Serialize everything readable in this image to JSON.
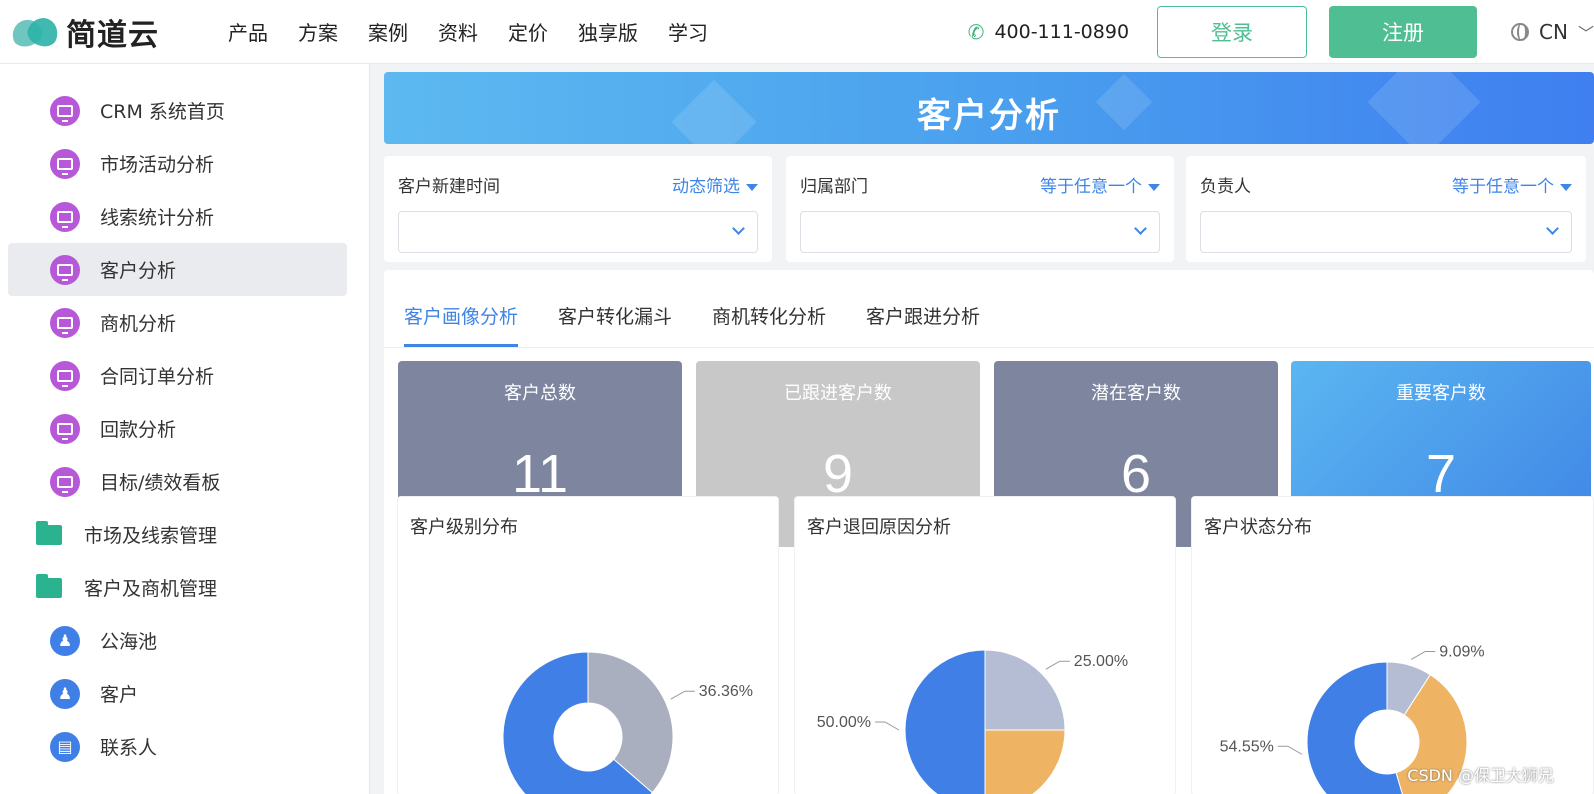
{
  "brand": {
    "name": "简道云"
  },
  "nav": [
    "产品",
    "方案",
    "案例",
    "资料",
    "定价",
    "独享版",
    "学习"
  ],
  "header": {
    "phone": "400-111-0890",
    "login": "登录",
    "register": "注册",
    "lang": "CN"
  },
  "sidebar": {
    "items": [
      {
        "label": "CRM 系统首页",
        "icon": "dashboard-icon",
        "type": "report"
      },
      {
        "label": "市场活动分析",
        "icon": "dashboard-icon",
        "type": "report"
      },
      {
        "label": "线索统计分析",
        "icon": "dashboard-icon",
        "type": "report"
      },
      {
        "label": "客户分析",
        "icon": "dashboard-icon",
        "type": "report",
        "active": true
      },
      {
        "label": "商机分析",
        "icon": "dashboard-icon",
        "type": "report"
      },
      {
        "label": "合同订单分析",
        "icon": "dashboard-icon",
        "type": "report"
      },
      {
        "label": "回款分析",
        "icon": "dashboard-icon",
        "type": "report"
      },
      {
        "label": "目标/绩效看板",
        "icon": "dashboard-icon",
        "type": "report"
      },
      {
        "label": "市场及线索管理",
        "icon": "folder-icon",
        "type": "folder"
      },
      {
        "label": "客户及商机管理",
        "icon": "folder-icon",
        "type": "folder"
      },
      {
        "label": "公海池",
        "icon": "user-icon",
        "type": "form"
      },
      {
        "label": "客户",
        "icon": "user-icon",
        "type": "form"
      },
      {
        "label": "联系人",
        "icon": "contact-icon",
        "type": "form"
      }
    ]
  },
  "banner": {
    "title": "客户分析"
  },
  "filters": [
    {
      "label": "客户新建时间",
      "op": "动态筛选"
    },
    {
      "label": "归属部门",
      "op": "等于任意一个"
    },
    {
      "label": "负责人",
      "op": "等于任意一个"
    }
  ],
  "tabs": [
    {
      "label": "客户画像分析",
      "active": true
    },
    {
      "label": "客户转化漏斗"
    },
    {
      "label": "商机转化分析"
    },
    {
      "label": "客户跟进分析"
    }
  ],
  "stats": [
    {
      "title": "客户总数",
      "value": "11",
      "color": "#7d859f"
    },
    {
      "title": "已跟进客户数",
      "value": "9",
      "color": "#c8c8c8"
    },
    {
      "title": "潜在客户数",
      "value": "6",
      "color": "#7d859f"
    },
    {
      "title": "重要客户数",
      "value": "7",
      "color": "#4ea6ee"
    }
  ],
  "chart_data": [
    {
      "type": "pie",
      "variant": "donut",
      "title": "客户级别分布",
      "slices": [
        {
          "value": 36.36,
          "label": "36.36%",
          "color": "#a9afbf"
        },
        {
          "value": 63.64,
          "label": "",
          "color": "#3f7fe6"
        }
      ]
    },
    {
      "type": "pie",
      "title": "客户退回原因分析",
      "slices": [
        {
          "value": 25.0,
          "label": "25.00%",
          "color": "#b4bdd3"
        },
        {
          "value": 25.0,
          "label": "",
          "color": "#eeb463"
        },
        {
          "value": 50.0,
          "label": "50.00%",
          "color": "#3f7fe6"
        }
      ]
    },
    {
      "type": "pie",
      "variant": "donut",
      "title": "客户状态分布",
      "slices": [
        {
          "value": 9.09,
          "label": "9.09%",
          "color": "#b4bdd3"
        },
        {
          "value": 36.36,
          "label": "",
          "color": "#eeb463"
        },
        {
          "value": 54.55,
          "label": "54.55%",
          "color": "#3f7fe6"
        }
      ]
    }
  ],
  "watermark": "CSDN @保卫大狮兄"
}
